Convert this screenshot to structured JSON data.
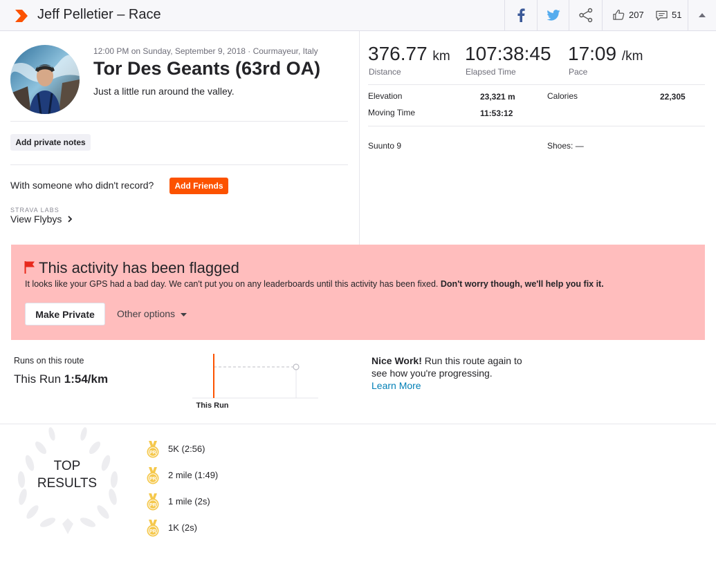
{
  "header": {
    "title": "Jeff Pelletier – Race",
    "kudos_count": "207",
    "comments_count": "51"
  },
  "activity": {
    "meta": "12:00 PM on Sunday, September 9, 2018 · Courmayeur, Italy",
    "title": "Tor Des Geants (63rd OA)",
    "description": "Just a little run around the valley.",
    "notes_button": "Add private notes",
    "with_someone": "With someone who didn't record?",
    "add_friends": "Add Friends",
    "labs_label": "STRAVA LABS",
    "flybys_label": "View Flybys"
  },
  "stats": {
    "distance": {
      "value": "376.77",
      "unit": "km",
      "label": "Distance"
    },
    "elapsed": {
      "value": "107:38:45",
      "label": "Elapsed Time"
    },
    "pace": {
      "value": "17:09",
      "unit": "/km",
      "label": "Pace"
    },
    "elevation": {
      "label": "Elevation",
      "value": "23,321 m"
    },
    "moving_time": {
      "label": "Moving Time",
      "value": "11:53:12"
    },
    "calories": {
      "label": "Calories",
      "value": "22,305"
    },
    "device": "Suunto 9",
    "shoes": "Shoes: —"
  },
  "flagged": {
    "title": "This activity has been flagged",
    "message": "It looks like your GPS had a bad day. We can't put you on any leaderboards until this activity has been fixed.",
    "message_bold": "Don't worry though, we'll help you fix it.",
    "make_private": "Make Private",
    "other_options": "Other options"
  },
  "route": {
    "label": "Runs on this route",
    "this_run_prefix": "This Run",
    "this_run_pace": "1:54/km",
    "chart_label": "This Run",
    "nice_bold": "Nice Work!",
    "nice_text": "Run this route again to see how you're progressing.",
    "learn_more": "Learn More"
  },
  "top_results": {
    "title_line1": "TOP",
    "title_line2": "RESULTS",
    "medal_text": "PR",
    "items": [
      {
        "label": "5K (2:56)"
      },
      {
        "label": "2 mile (1:49)"
      },
      {
        "label": "1 mile (2s)"
      },
      {
        "label": "1K (2s)"
      }
    ]
  },
  "colors": {
    "brand": "#fc5200",
    "flag_bg": "#ffbdbd",
    "link": "#007fb6",
    "medal": "#f5c84c"
  }
}
